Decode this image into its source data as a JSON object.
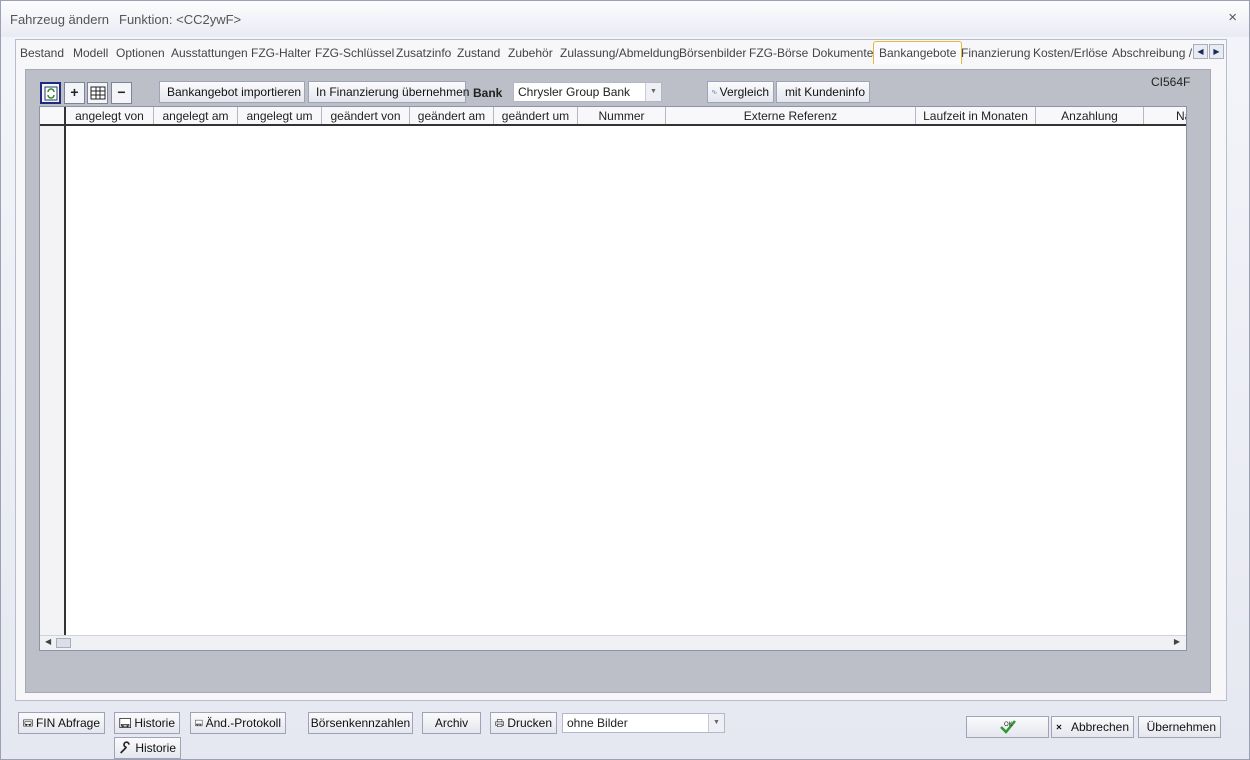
{
  "window": {
    "title": "Fahrzeug ändern",
    "function": "Funktion: <CC2ywF>",
    "close_glyph": "×"
  },
  "tabs": [
    {
      "label": "Bestand"
    },
    {
      "label": "Modell"
    },
    {
      "label": "Optionen"
    },
    {
      "label": "Ausstattungen"
    },
    {
      "label": "FZG-Halter"
    },
    {
      "label": "FZG-Schlüssel"
    },
    {
      "label": "Zusatzinfo"
    },
    {
      "label": "Zustand"
    },
    {
      "label": "Zubehör"
    },
    {
      "label": "Zulassung/Abmeldung"
    },
    {
      "label": "Börsenbilder"
    },
    {
      "label": "FZG-Börse"
    },
    {
      "label": "Dokumente"
    },
    {
      "label": "Bankangebote",
      "active": true
    },
    {
      "label": "Finanzierung"
    },
    {
      "label": "Kosten/Erlöse"
    },
    {
      "label": "Abschreibung / V"
    }
  ],
  "toolbar": {
    "refresh_icon": "refresh-icon",
    "add_glyph": "+",
    "remove_glyph": "−",
    "import_label": "Bankangebot importieren",
    "transfer_label": "In Finanzierung übernehmen",
    "bank_label": "Bank",
    "bank_value": "Chrysler Group Bank",
    "compare_label": "Vergleich",
    "customer_info_label": "mit Kundeninfo",
    "code": "CI564F"
  },
  "grid": {
    "columns": [
      "angelegt von",
      "angelegt am",
      "angelegt um",
      "geändert von",
      "geändert am",
      "geändert um",
      "Nummer",
      "Externe Referenz",
      "Laufzeit in Monaten",
      "Anzahlung",
      "Na"
    ]
  },
  "footer": {
    "fin_label": "FIN Abfrage",
    "history_label": "Historie",
    "history2_label": "Historie",
    "change_log_label": "Änd.-Protokoll",
    "exchange_figures_label": "Börsenkennzahlen",
    "archive_label": "Archiv",
    "print_label": "Drucken",
    "print_option": "ohne Bilder",
    "ok_label": "OK",
    "cancel_label": "Abbrechen",
    "apply_label": "Übernehmen"
  },
  "colors": {
    "active_tab_border": "#e8b83a",
    "panel_bg": "#bdbfc8",
    "ok_check": "#2e9a2e"
  }
}
